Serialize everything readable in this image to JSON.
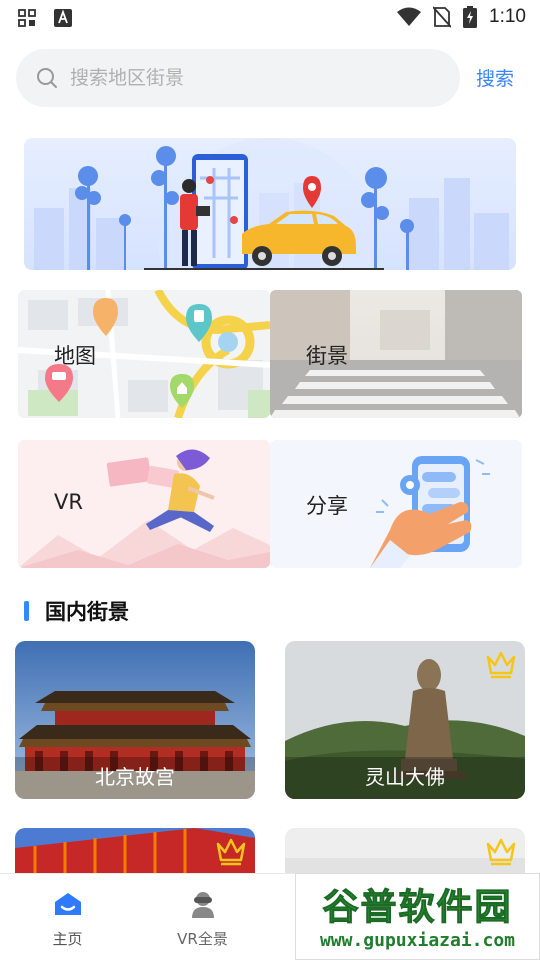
{
  "status_bar": {
    "time": "1:10"
  },
  "search": {
    "placeholder": "搜索地区街景",
    "button_label": "搜索"
  },
  "tiles": {
    "map": "地图",
    "street_view": "街景",
    "vr": "VR",
    "share": "分享"
  },
  "section": {
    "title": "国内街景"
  },
  "places": [
    {
      "name": "北京故宫",
      "premium": false
    },
    {
      "name": "灵山大佛",
      "premium": true
    },
    {
      "name": "",
      "premium": true
    },
    {
      "name": "",
      "premium": true
    }
  ],
  "nav": {
    "items": [
      {
        "label": "主页",
        "icon": "home-icon",
        "active": true
      },
      {
        "label": "VR全景",
        "icon": "vr-headset-icon",
        "active": false
      }
    ]
  },
  "watermark": {
    "title": "谷普软件园",
    "url": "www.gupuxiazai.com"
  },
  "colors": {
    "accent": "#3a86ff",
    "section_bar": "#2f8bff",
    "crown": "#f5c518"
  }
}
